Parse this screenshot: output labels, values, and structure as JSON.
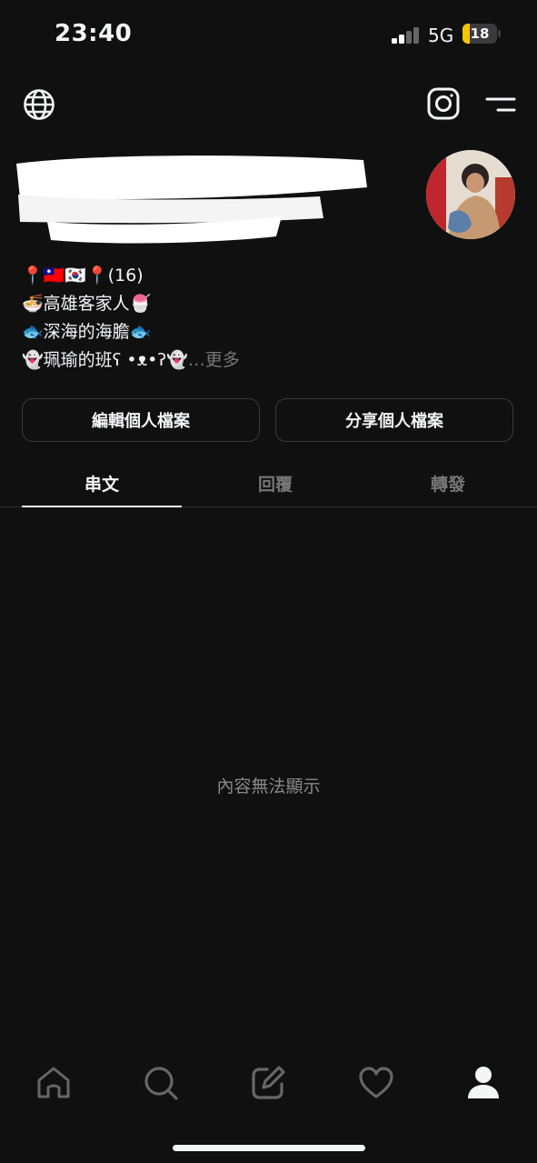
{
  "status_bar": {
    "time": "23:40",
    "network": "5G",
    "battery": "18"
  },
  "profile": {
    "bio_lines": [
      "📍🇹🇼🇰🇷📍(16)",
      "🍜高雄客家人🍧",
      "🐟深海的海膽🐟",
      "👻珮瑜的班ʕ •ᴥ•ʔ👻"
    ],
    "more_label": "…更多"
  },
  "buttons": {
    "edit": "編輯個人檔案",
    "share": "分享個人檔案"
  },
  "tabs": [
    {
      "label": "串文",
      "active": true
    },
    {
      "label": "回覆",
      "active": false
    },
    {
      "label": "轉發",
      "active": false
    }
  ],
  "empty_state": "內容無法顯示",
  "colors": {
    "background": "#101010",
    "text": "#f3f5f7",
    "muted": "#777777",
    "battery": "#f5c400"
  },
  "icons": {
    "header_left": "globe-icon",
    "header_right": [
      "instagram-icon",
      "menu-icon"
    ],
    "nav": [
      "home-icon",
      "search-icon",
      "compose-icon",
      "heart-icon",
      "profile-icon"
    ]
  }
}
